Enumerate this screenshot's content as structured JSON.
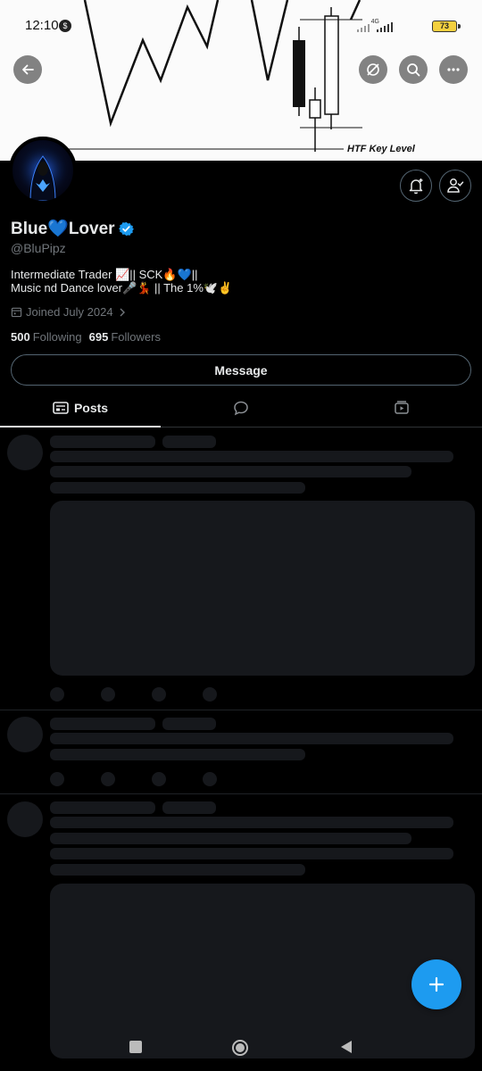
{
  "status_bar": {
    "time": "12:10",
    "network_label": "4G",
    "battery": "73"
  },
  "banner": {
    "annotation": "HTF Key Level"
  },
  "profile": {
    "display_name": "Blue💙Lover",
    "handle": "@BluPipz",
    "bio_line1": "Intermediate Trader 📈|| SCK🔥💙||",
    "bio_line2": "Music nd Dance lover🎤💃 || The 1%🕊️✌️",
    "joined": "Joined July 2024",
    "following_count": "500",
    "following_label": "Following",
    "followers_count": "695",
    "followers_label": "Followers",
    "verified": true
  },
  "actions": {
    "message_label": "Message"
  },
  "tabs": [
    {
      "label": "Posts",
      "icon": "posts-icon",
      "active": true
    },
    {
      "label": "",
      "icon": "replies-icon",
      "active": false
    },
    {
      "label": "",
      "icon": "media-icon",
      "active": false
    }
  ],
  "colors": {
    "accent": "#1d9bf0",
    "background": "#000000",
    "verified": "#1d9bf0",
    "skeleton": "#16181c"
  }
}
